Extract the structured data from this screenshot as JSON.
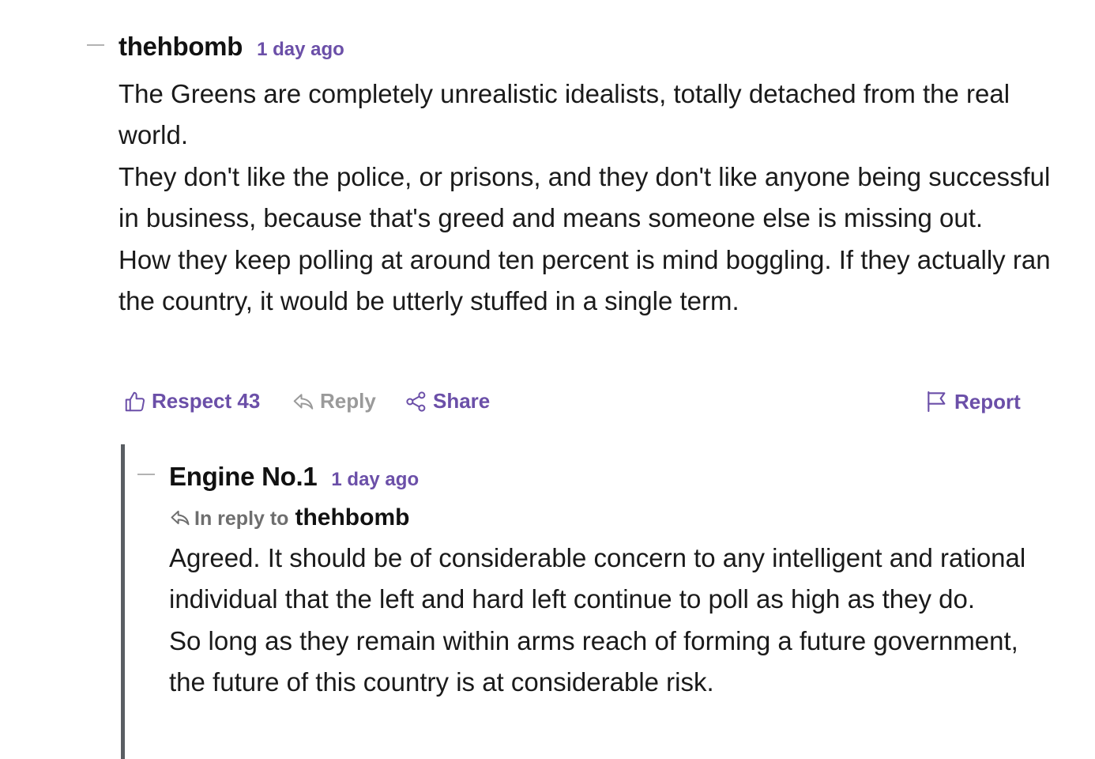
{
  "comments": [
    {
      "author": "thehbomb",
      "time": "1 day ago",
      "paragraphs": [
        "The Greens are completely unrealistic idealists, totally detached from the real world.",
        "They don't like the police, or prisons, and they don't like anyone being successful in business, because that's greed and means someone else is missing out.",
        "How they keep polling at around ten percent is mind boggling. If they actually ran the country, it would be utterly stuffed in a single term."
      ],
      "actions": {
        "respect_label": "Respect 43",
        "reply_label": "Reply",
        "share_label": "Share",
        "report_label": "Report"
      }
    },
    {
      "author": "Engine No.1",
      "time": "1 day ago",
      "reply_to_label": "In reply to",
      "reply_to_name": "thehbomb",
      "paragraphs": [
        "Agreed. It should be of considerable concern to any intelligent and rational individual that the left and hard left continue to poll as high as they do.",
        "So long as they remain within arms reach of forming a future government, the future of this country is at considerable risk."
      ]
    }
  ],
  "icons": {
    "respect": "thumbs-up-icon",
    "reply": "reply-arrow-icon",
    "share": "share-nodes-icon",
    "report": "flag-icon"
  },
  "colors": {
    "accent": "#6b4fa8",
    "muted": "#9a9a9a",
    "text": "#1a1a1a",
    "thread_line": "#5a5e63"
  }
}
